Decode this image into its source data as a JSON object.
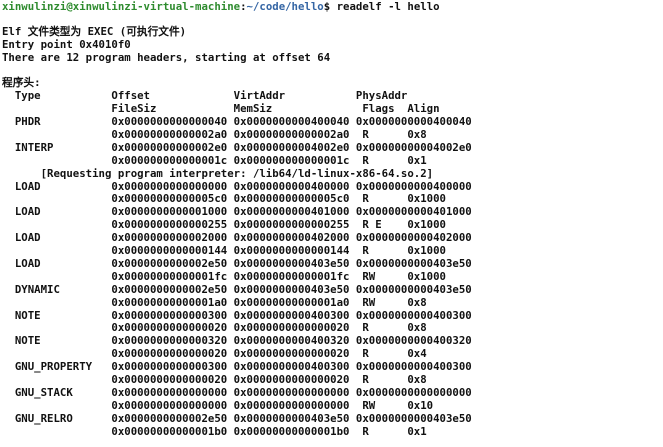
{
  "prompt": {
    "user_host": "xinwulinzi@xinwulinzi-virtual-machine",
    "separator": ":",
    "path": "~/code/hello",
    "symbol": "$ ",
    "command": "readelf -l hello"
  },
  "output": {
    "elf_type": "Elf 文件类型为 EXEC (可执行文件)",
    "entry_point": "Entry point 0x4010f0",
    "summary": "There are 12 program headers, starting at offset 64",
    "section_title": "程序头:",
    "header_row1": "  Type           Offset             VirtAddr           PhysAddr",
    "header_row2": "                 FileSiz            MemSiz              Flags  Align",
    "rows": [
      "  PHDR           0x0000000000000040 0x0000000000400040 0x0000000000400040",
      "                 0x00000000000002a0 0x00000000000002a0  R      0x8",
      "  INTERP         0x00000000000002e0 0x00000000004002e0 0x00000000004002e0",
      "                 0x000000000000001c 0x000000000000001c  R      0x1",
      "      [Requesting program interpreter: /lib64/ld-linux-x86-64.so.2]",
      "  LOAD           0x0000000000000000 0x0000000000400000 0x0000000000400000",
      "                 0x00000000000005c0 0x00000000000005c0  R      0x1000",
      "  LOAD           0x0000000000001000 0x0000000000401000 0x0000000000401000",
      "                 0x0000000000000255 0x0000000000000255  R E    0x1000",
      "  LOAD           0x0000000000002000 0x0000000000402000 0x0000000000402000",
      "                 0x0000000000000144 0x0000000000000144  R      0x1000",
      "  LOAD           0x0000000000002e50 0x0000000000403e50 0x0000000000403e50",
      "                 0x00000000000001fc 0x00000000000001fc  RW     0x1000",
      "  DYNAMIC        0x0000000000002e50 0x0000000000403e50 0x0000000000403e50",
      "                 0x00000000000001a0 0x00000000000001a0  RW     0x8",
      "  NOTE           0x0000000000000300 0x0000000000400300 0x0000000000400300",
      "                 0x0000000000000020 0x0000000000000020  R      0x8",
      "  NOTE           0x0000000000000320 0x0000000000400320 0x0000000000400320",
      "                 0x0000000000000020 0x0000000000000020  R      0x4",
      "  GNU_PROPERTY   0x0000000000000300 0x0000000000400300 0x0000000000400300",
      "                 0x0000000000000020 0x0000000000000020  R      0x8",
      "  GNU_STACK      0x0000000000000000 0x0000000000000000 0x0000000000000000",
      "                 0x0000000000000000 0x0000000000000000  RW     0x10",
      "  GNU_RELRO      0x0000000000002e50 0x0000000000403e50 0x0000000000403e50",
      "                 0x00000000000001b0 0x00000000000001b0  R      0x1"
    ]
  },
  "colors": {
    "user_host": "#2e8b2e",
    "path": "#3465a4",
    "text": "#111111",
    "background": "#ffffff"
  }
}
